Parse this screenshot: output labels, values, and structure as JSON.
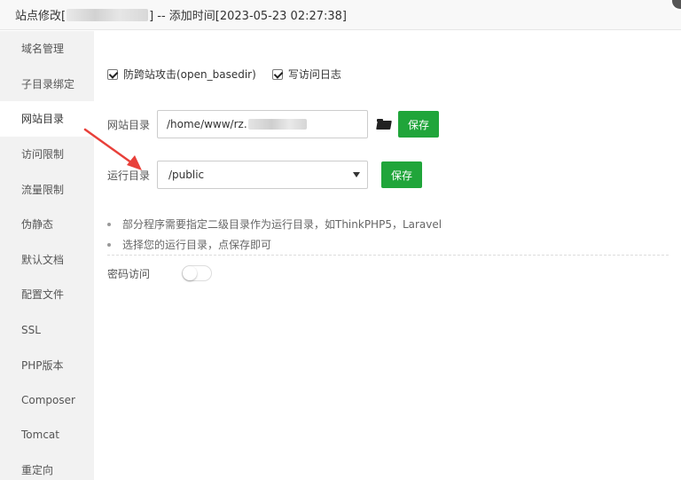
{
  "titlebar": {
    "prefix": "站点修改[",
    "suffix": "] -- 添加时间[2023-05-23 02:27:38]"
  },
  "sidebar": {
    "items": [
      {
        "label": "域名管理"
      },
      {
        "label": "子目录绑定"
      },
      {
        "label": "网站目录",
        "active": true
      },
      {
        "label": "访问限制"
      },
      {
        "label": "流量限制"
      },
      {
        "label": "伪静态"
      },
      {
        "label": "默认文档"
      },
      {
        "label": "配置文件"
      },
      {
        "label": "SSL"
      },
      {
        "label": "PHP版本"
      },
      {
        "label": "Composer"
      },
      {
        "label": "Tomcat"
      },
      {
        "label": "重定向"
      }
    ]
  },
  "options": {
    "anti_xss": {
      "label": "防跨站攻击(open_basedir)",
      "checked": true
    },
    "access_log": {
      "label": "写访问日志",
      "checked": true
    }
  },
  "site_dir": {
    "label": "网站目录",
    "value": "/home/www/rz.",
    "save_label": "保存"
  },
  "run_dir": {
    "label": "运行目录",
    "selected": "/public",
    "save_label": "保存"
  },
  "tips": [
    "部分程序需要指定二级目录作为运行目录，如ThinkPHP5，Laravel",
    "选择您的运行目录，点保存即可"
  ],
  "password_access": {
    "label": "密码访问",
    "enabled": false
  },
  "colors": {
    "save_button": "#20a53a",
    "arrow": "#e8403a"
  }
}
